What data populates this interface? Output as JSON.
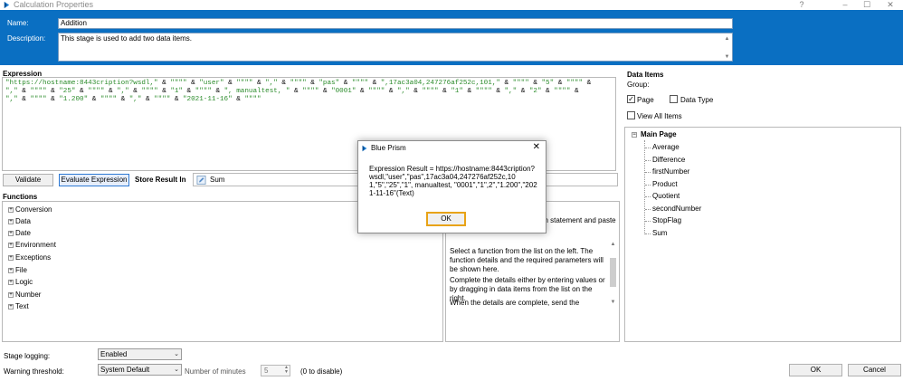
{
  "window": {
    "title": "Calculation Properties",
    "controls": {
      "help": "?",
      "minimize": "–",
      "maximize": "☐",
      "close": "✕"
    }
  },
  "header": {
    "name_label": "Name:",
    "name_value": "Addition",
    "description_label": "Description:",
    "description_value": "This stage is used to add two data items."
  },
  "expression": {
    "section_title": "Expression",
    "lines": [
      [
        "\"https://hostname:8443cription?wsdl,\"",
        " & ",
        "\"\"\"\"",
        " & ",
        "\"user\"",
        " & ",
        "\"\"\"\"",
        " & ",
        "\",\"",
        " & ",
        "\"\"\"\"",
        " & ",
        "\"pas\"",
        " & ",
        "\"\"\"\"",
        " & ",
        "\",17ac3a04,247276af252c,101,\"",
        " & ",
        "\"\"\"\"",
        " & ",
        "\"5\"",
        " & ",
        "\"\"\"\"",
        " &"
      ],
      [
        "\",\"",
        " & ",
        "\"\"\"\"",
        " & ",
        "\"25\"",
        " & ",
        "\"\"\"\"",
        " & ",
        "\",\"",
        " & ",
        "\"\"\"\"",
        " & ",
        "\"1\"",
        " & ",
        "\"\"\"\"",
        " & ",
        "\", manualtest, \"",
        " & ",
        "\"\"\"\"",
        " & ",
        "\"0001\"",
        " & ",
        "\"\"\"\"",
        " & ",
        "\",\"",
        " & ",
        "\"\"\"\"",
        " & ",
        "\"1\"",
        " & ",
        "\"\"\"\"",
        " & ",
        "\",\"",
        " & ",
        "\"2\"",
        " & ",
        "\"\"\"\"",
        " &"
      ],
      [
        "\",\"",
        " & ",
        "\"\"\"\"",
        " & ",
        "\"1.200\"",
        " & ",
        "\"\"\"\"",
        " & ",
        "\",\"",
        " & ",
        "\"\"\"\"",
        " & ",
        "\"2021-11-16\"",
        " & ",
        "\"\"\"\""
      ]
    ]
  },
  "toolbar": {
    "validate_label": "Validate",
    "evaluate_label": "Evaluate Expression",
    "store_result_label": "Store Result In",
    "store_result_value": "Sum"
  },
  "functions": {
    "section_title": "Functions",
    "items": [
      "Conversion",
      "Data",
      "Date",
      "Environment",
      "Exceptions",
      "File",
      "Logic",
      "Number",
      "Text"
    ]
  },
  "help": {
    "partial_text": "on statement and paste",
    "para1": "Select a function from the list on the left. The function details and the required parameters will be shown here.",
    "para2": "Complete the details either by entering values or by dragging in data items from the list on the right.",
    "para3": "When the details are complete, send the"
  },
  "data_items": {
    "section_title": "Data Items",
    "group_label": "Group:",
    "page_label": "Page",
    "page_checked": true,
    "datatype_label": "Data Type",
    "datatype_checked": false,
    "view_all_label": "View All Items",
    "view_all_checked": false,
    "root": "Main Page",
    "items": [
      "Average",
      "Difference",
      "firstNumber",
      "Product",
      "Quotient",
      "secondNumber",
      "StopFlag",
      "Sum"
    ]
  },
  "bottom": {
    "stage_logging_label": "Stage logging:",
    "stage_logging_value": "Enabled",
    "warning_label": "Warning threshold:",
    "warning_value": "System Default",
    "minutes_label": "Number of minutes",
    "minutes_value": "5",
    "disable_hint": "(0 to disable)",
    "ok_label": "OK",
    "cancel_label": "Cancel"
  },
  "dialog": {
    "title": "Blue Prism",
    "result_text": "Expression Result = https://hostname:8443cription?wsdl,\"user\",\"pas\",17ac3a04,247276af252c,101,\"5\",\"25\",\"1\", manualtest, \"0001\",\"1\",2\",\"1.200\",\"2021-11-16\"(Text)",
    "ok_label": "OK"
  },
  "colors": {
    "header_bg": "#0a6fc2",
    "string_literal": "#2a8b2a",
    "ok_focus": "#e8a317"
  }
}
